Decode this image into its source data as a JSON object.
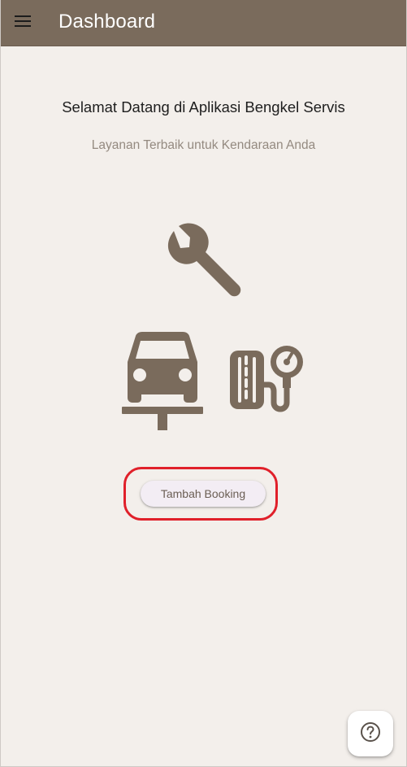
{
  "appbar": {
    "title": "Dashboard",
    "menu_icon": "menu-icon",
    "background": "#7a6b5c"
  },
  "main": {
    "welcome_text": "Selamat Datang di Aplikasi Bengkel Servis",
    "subtitle": "Layanan Terbaik untuk Kendaraan Anda",
    "illustration_icons": [
      "wrench-icon",
      "car-lift-icon",
      "tire-pressure-icon"
    ],
    "icon_color": "#7a6b5c",
    "booking_button_label": "Tambah Booking",
    "highlight_color": "#e0202a"
  },
  "fab": {
    "icon": "help-icon"
  },
  "colors": {
    "page_background": "#f3efeb",
    "subtitle_text": "#948a80"
  }
}
